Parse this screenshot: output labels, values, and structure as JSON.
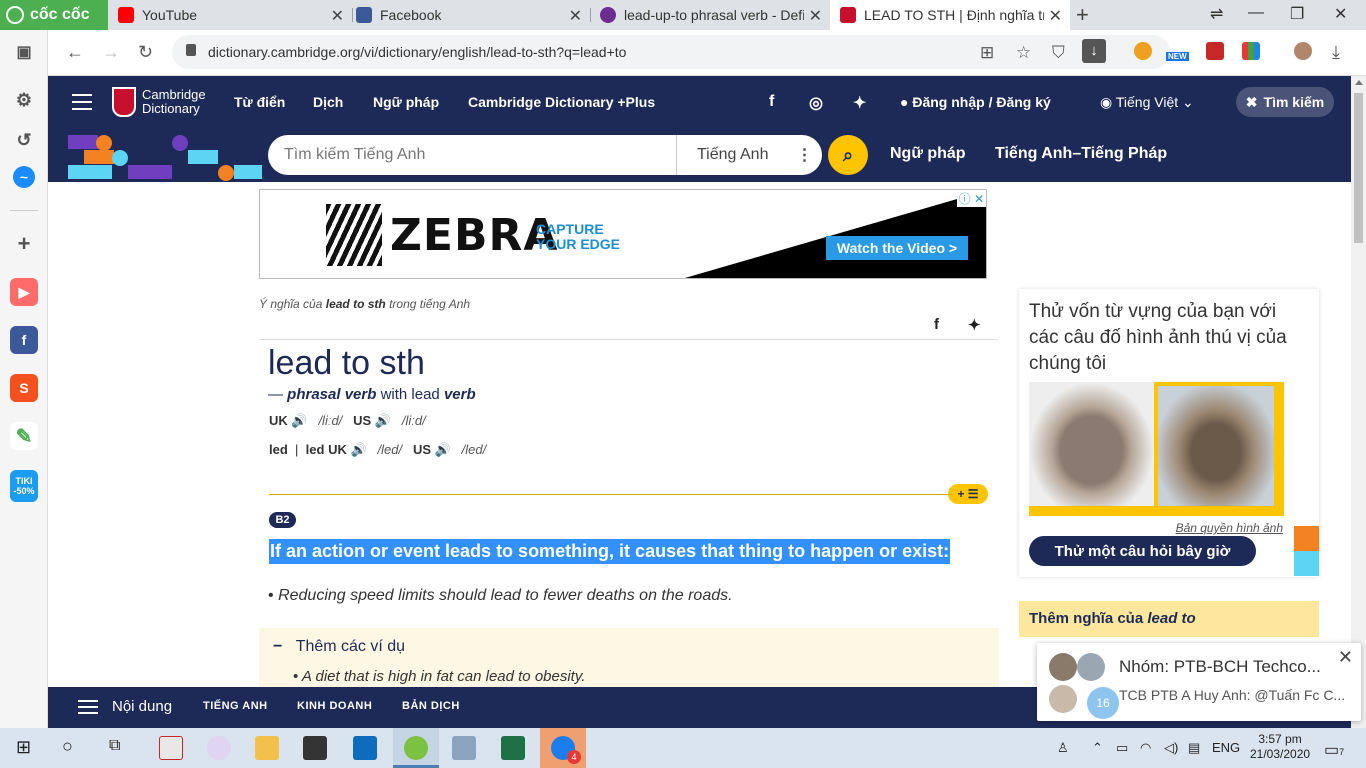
{
  "browser": {
    "brand": "cốc cốc",
    "tabs": [
      {
        "title": "YouTube"
      },
      {
        "title": "Facebook"
      },
      {
        "title": "lead-up-to phrasal verb - Defi"
      },
      {
        "title": "LEAD TO STH | Định nghĩa tro"
      }
    ],
    "url": "dictionary.cambridge.org/vi/dictionary/english/lead-to-sth?q=lead+to",
    "ext_badge": "NEW"
  },
  "sidebar": {
    "tiki_label": "TIKI",
    "tiki_promo": "-50%"
  },
  "header": {
    "logo_line1": "Cambridge",
    "logo_line2": "Dictionary",
    "nav": [
      "Từ điển",
      "Dịch",
      "Ngữ pháp",
      "Cambridge Dictionary +Plus"
    ],
    "login": "Đăng nhập / Đăng ký",
    "language": "Tiếng Việt",
    "search_toggle": "Tìm kiếm"
  },
  "search": {
    "placeholder": "Tìm kiếm Tiếng Anh",
    "lang": "Tiếng Anh",
    "links": [
      "Ngữ pháp",
      "Tiếng Anh–Tiếng Pháp"
    ]
  },
  "ad": {
    "brand": "ZEBRA",
    "tagline1": "CAPTURE",
    "tagline2": "YOUR EDGE",
    "cta": "Watch the Video >"
  },
  "entry": {
    "meaning_prefix": "Ý nghĩa của",
    "meaning_word": "lead to sth",
    "meaning_suffix": "trong tiếng Anh",
    "headword": "lead to sth",
    "pos_dash": "—",
    "pos_type": "phrasal verb",
    "pos_with": "with lead",
    "pos_verb": "verb",
    "pron1": {
      "uk": "UK",
      "uk_ipa": "/liːd/",
      "us": "US",
      "us_ipa": "/liːd/"
    },
    "pron2": {
      "form": "led",
      "sep": "|",
      "form2": "led",
      "uk": "UK",
      "uk_ipa": "/led/",
      "us": "US",
      "us_ipa": "/led/"
    },
    "level": "B2",
    "definition": "If an action or event leads to something, it causes that thing to happen or exist:",
    "example": "Reducing speed limits should lead to fewer deaths on the roads.",
    "more_examples_title": "Thêm các ví dụ",
    "more_example_1": "A diet that is high in fat can lead to obesity."
  },
  "quiz": {
    "prompt": "Thử vốn từ vựng của bạn với các câu đố hình ảnh thú vị của chúng tôi",
    "credit": "Bản quyền hình ảnh",
    "button": "Thử một câu hỏi bây giờ"
  },
  "more_meanings": {
    "prefix": "Thêm nghĩa của",
    "word": "lead to"
  },
  "bottom_nav": {
    "menu": "Nội dung",
    "items": [
      "TIẾNG ANH",
      "KINH DOANH",
      "BẢN DỊCH"
    ]
  },
  "notification": {
    "title": "Nhóm: PTB-BCH Techco...",
    "body": "TCB PTB A Huy Anh: @Tuấn Fc C...",
    "count": "16"
  },
  "taskbar": {
    "lang": "ENG",
    "time": "3:57 pm",
    "date": "21/03/2020",
    "zalo_badge": "4",
    "action_count": "7"
  }
}
